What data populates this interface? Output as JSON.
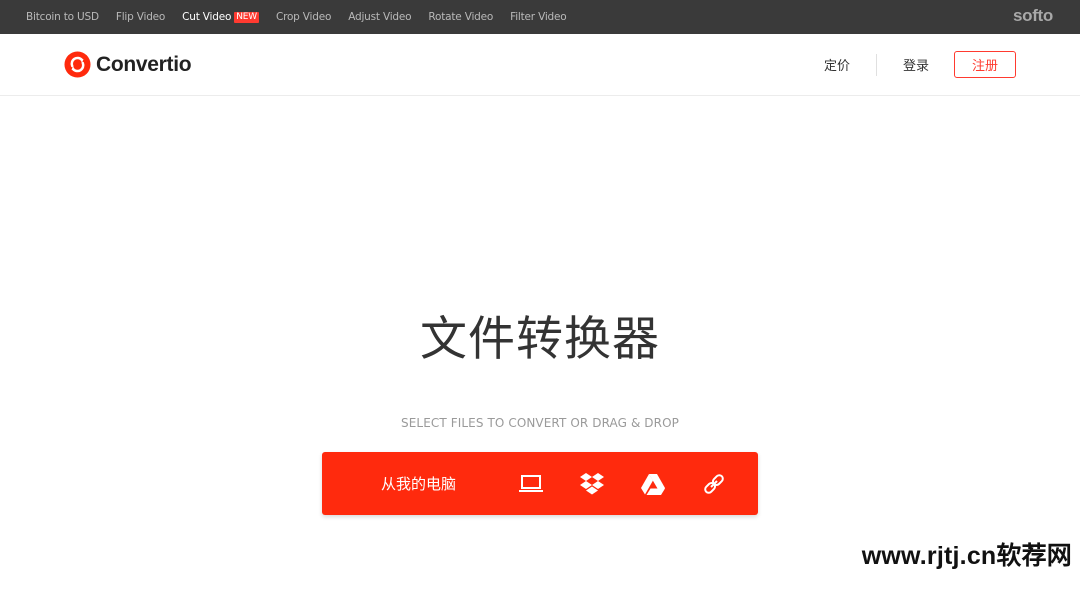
{
  "topbar": {
    "links": [
      {
        "label": "Bitcoin to USD"
      },
      {
        "label": "Flip Video"
      },
      {
        "label": "Cut Video",
        "badge": "NEW"
      },
      {
        "label": "Crop Video"
      },
      {
        "label": "Adjust Video"
      },
      {
        "label": "Rotate Video"
      },
      {
        "label": "Filter Video"
      }
    ],
    "brand": "softo"
  },
  "header": {
    "brand_name": "Convertio",
    "brand_color": "#ff2a0d",
    "nav": {
      "pricing": "定价",
      "login": "登录",
      "signup": "注册"
    }
  },
  "hero": {
    "title": "文件转换器",
    "subtitle": "SELECT FILES TO CONVERT OR DRAG & DROP"
  },
  "upload": {
    "local_label": "从我的电脑",
    "icons": [
      "computer-icon",
      "dropbox-icon",
      "google-drive-icon",
      "url-link-icon"
    ]
  },
  "watermark": "www.rjtj.cn软荐网"
}
